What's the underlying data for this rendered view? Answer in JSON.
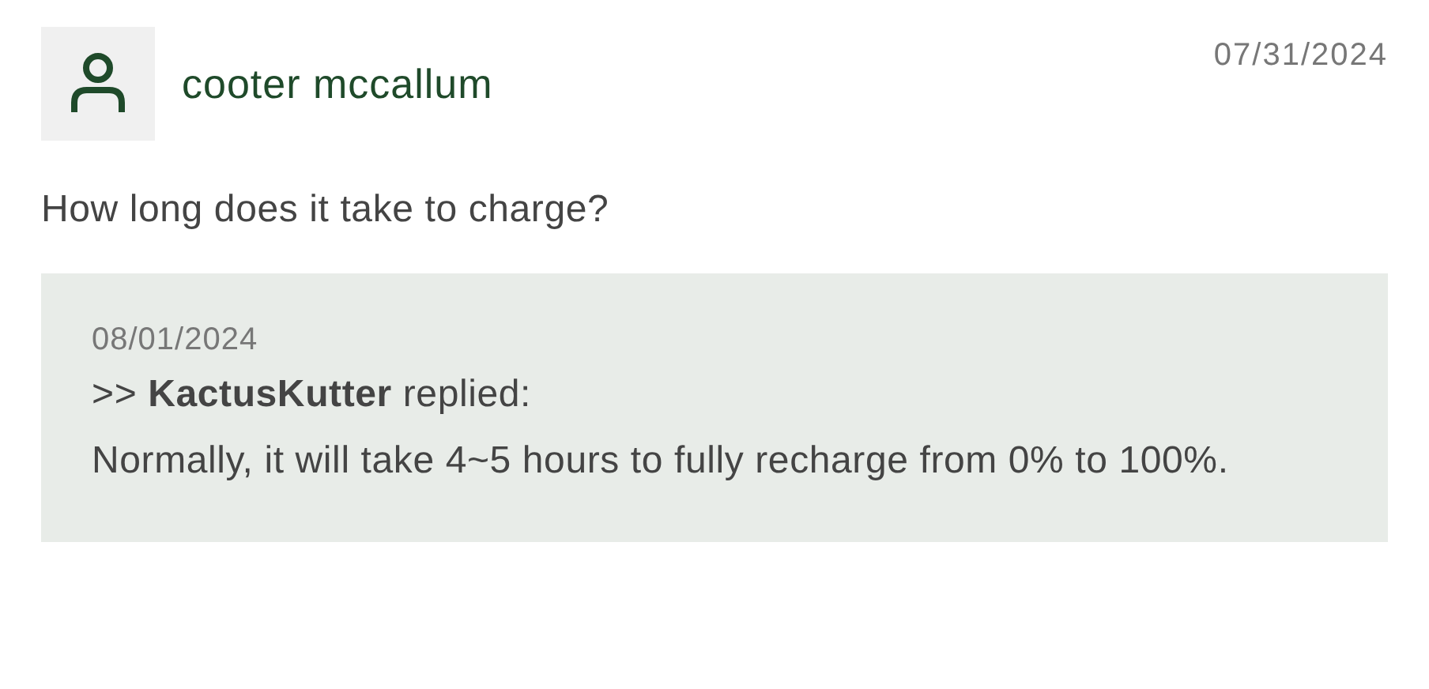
{
  "review": {
    "author": "cooter mccallum",
    "date": "07/31/2024",
    "question": "How long does it take to charge?"
  },
  "reply": {
    "date": "08/01/2024",
    "header": ">> **KactusKutter** replied:",
    "text": "Normally, it will take 4~5 hours to fully recharge from 0% to 100%."
  }
}
